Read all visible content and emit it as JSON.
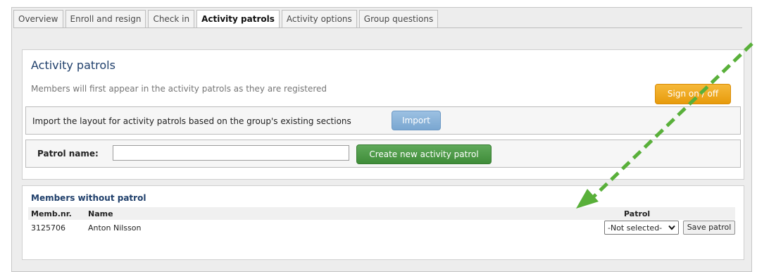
{
  "tabs": [
    {
      "label": "Overview",
      "active": false
    },
    {
      "label": "Enroll and resign",
      "active": false
    },
    {
      "label": "Check in",
      "active": false
    },
    {
      "label": "Activity patrols",
      "active": true
    },
    {
      "label": "Activity options",
      "active": false
    },
    {
      "label": "Group questions",
      "active": false
    }
  ],
  "activity_panel": {
    "title": "Activity patrols",
    "description": "Members will first appear in the activity patrols as they are registered",
    "sign_button": "Sign on / off",
    "import_text": "Import the layout for activity patrols based on the group's existing sections",
    "import_button": "Import",
    "patrol_name_label": "Patrol name:",
    "patrol_name_value": "",
    "create_button": "Create new activity patrol"
  },
  "members_panel": {
    "title": "Members without patrol",
    "columns": {
      "number": "Memb.nr.",
      "name": "Name",
      "patrol": "Patrol"
    },
    "rows": [
      {
        "number": "3125706",
        "name": "Anton Nilsson",
        "patrol_selected": "-Not selected-",
        "save_label": "Save patrol"
      }
    ]
  },
  "colors": {
    "title_blue": "#1f3f6b",
    "sign_button": "#f0a81f",
    "import_button": "#8bb3da",
    "create_button": "#4e9a48",
    "annotation_arrow": "#59b03a"
  },
  "icons": {
    "select_caret": "chevron-down-icon"
  }
}
